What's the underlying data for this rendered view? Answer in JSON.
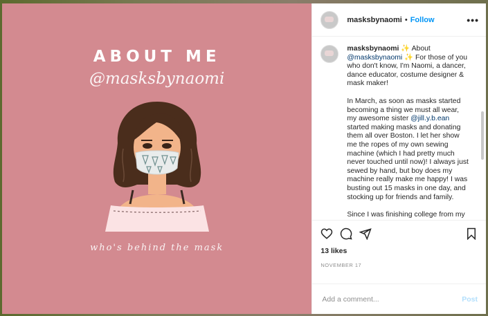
{
  "image": {
    "title": "ABOUT ME",
    "handle": "@masksbynaomi",
    "caption": "who's behind the mask",
    "bg_color": "#d38a90"
  },
  "header": {
    "username": "masksbynaomi",
    "separator": "•",
    "follow_label": "Follow",
    "more_icon": "more-horizontal-icon"
  },
  "caption": {
    "username": "masksbynaomi",
    "sparkle": "✨",
    "about": "About",
    "handle_mention": "@masksbynaomi",
    "para1": "For those of you who don't know, I'm Naomi, a dancer, dance educator, costume designer & mask maker!",
    "para2_a": "In March, as soon as masks started becoming a thing we must all wear, my awesome sister",
    "para2_mention": "@jill.y.b.ean",
    "para2_b": "started making masks and donating them all over Boston. I let her show me the ropes of my own sewing machine (which I had pretty much never touched until now)! I always just sewed by hand, but boy does my machine really make me happy! I was busting out 15 masks in one day, and stocking up for friends and family.",
    "para3": "Since I was finishing college from my kitchen and had a hard time dancing to my apartment full of people, I started to"
  },
  "actions": {
    "like_icon": "heart-icon",
    "comment_icon": "comment-icon",
    "share_icon": "share-icon",
    "save_icon": "bookmark-icon",
    "likes": "13 likes",
    "date": "NOVEMBER 17"
  },
  "comment_box": {
    "placeholder": "Add a comment...",
    "post_label": "Post"
  }
}
